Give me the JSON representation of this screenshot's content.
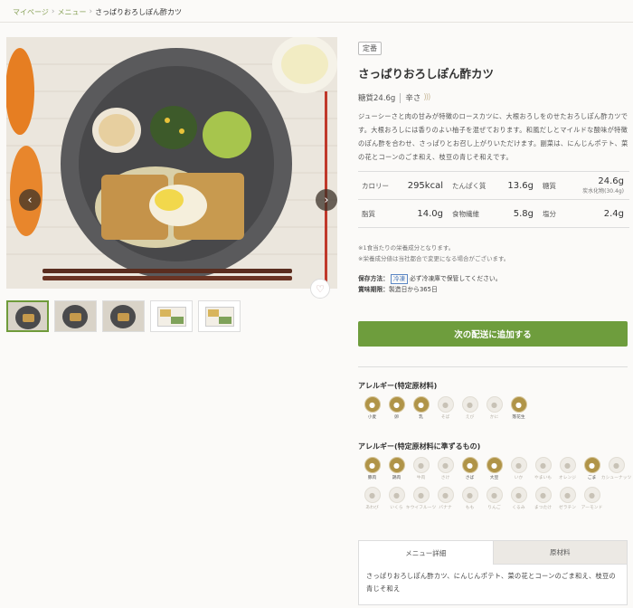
{
  "breadcrumb": {
    "items": [
      "マイページ",
      "メニュー",
      "さっぱりおろしぽん酢カツ"
    ]
  },
  "product": {
    "tag": "定番",
    "title": "さっぱりおろしぽん酢カツ",
    "carb_label": "糖質24.6g",
    "spice_label": "辛さ",
    "description": "ジューシーさと肉の甘みが特徴のロースカツに、大根おろしをのせたおろしぽん酢カツです。大根おろしには香りのよい柚子を混ぜております。和風だしとマイルドな酸味が特徴のぽん酢を合わせ、さっぱりとお召し上がりいただけます。副菜は、にんじんポテト、菜の花とコーンのごま和え、枝豆の青じそ和えです。"
  },
  "nutrition": [
    [
      {
        "label": "カロリー",
        "value": "295kcal"
      },
      {
        "label": "たんぱく質",
        "value": "13.6g"
      },
      {
        "label": "糖質",
        "value": "24.6g",
        "sub": "炭水化物(30.4g)"
      }
    ],
    [
      {
        "label": "脂質",
        "value": "14.0g"
      },
      {
        "label": "食物繊維",
        "value": "5.8g"
      },
      {
        "label": "塩分",
        "value": "2.4g"
      }
    ]
  ],
  "notes": [
    "※1食当たりの栄養成分となります。",
    "※栄養成分値は当社都合で変更になる場合がございます。"
  ],
  "storage": {
    "method_label": "保存方法：",
    "frozen": "冷凍",
    "method_text": "必ず冷凍庫で保管してください。",
    "expiry_label": "賞味期限：",
    "expiry_text": "製造日から365日"
  },
  "add_button": "次の配送に追加する",
  "allergy": {
    "title": "アレルギー(特定原材料)",
    "items": [
      {
        "name": "小麦",
        "on": true
      },
      {
        "name": "卵",
        "on": true
      },
      {
        "name": "乳",
        "on": true
      },
      {
        "name": "そば",
        "on": false
      },
      {
        "name": "えび",
        "on": false
      },
      {
        "name": "かに",
        "on": false
      },
      {
        "name": "落花生",
        "on": true
      }
    ]
  },
  "allergy_similar": {
    "title": "アレルギー(特定原材料に準ずるもの)",
    "items": [
      {
        "name": "豚肉",
        "on": true
      },
      {
        "name": "鶏肉",
        "on": true
      },
      {
        "name": "牛肉",
        "on": false
      },
      {
        "name": "さけ",
        "on": false
      },
      {
        "name": "さば",
        "on": true
      },
      {
        "name": "大豆",
        "on": true
      },
      {
        "name": "いか",
        "on": false
      },
      {
        "name": "やまいも",
        "on": false
      },
      {
        "name": "オレンジ",
        "on": false
      },
      {
        "name": "ごま",
        "on": true
      },
      {
        "name": "カシューナッツ",
        "on": false
      },
      {
        "name": "あわび",
        "on": false
      },
      {
        "name": "いくら",
        "on": false
      },
      {
        "name": "キウイフルーツ",
        "on": false
      },
      {
        "name": "バナナ",
        "on": false
      },
      {
        "name": "もも",
        "on": false
      },
      {
        "name": "りんご",
        "on": false
      },
      {
        "name": "くるみ",
        "on": false
      },
      {
        "name": "まつたけ",
        "on": false
      },
      {
        "name": "ゼラチン",
        "on": false
      },
      {
        "name": "アーモンド",
        "on": false
      }
    ]
  },
  "tabs": {
    "active": "メニュー詳細",
    "inactive": "原材料",
    "body": "さっぱりおろしぽん酢カツ、にんじんポテト、菜の花とコーンのごま和え、枝豆の青じそ和え"
  },
  "colors": {
    "accent": "#6e9d3d",
    "allergen_on": "#b09448",
    "allergen_off": "#efece6"
  }
}
